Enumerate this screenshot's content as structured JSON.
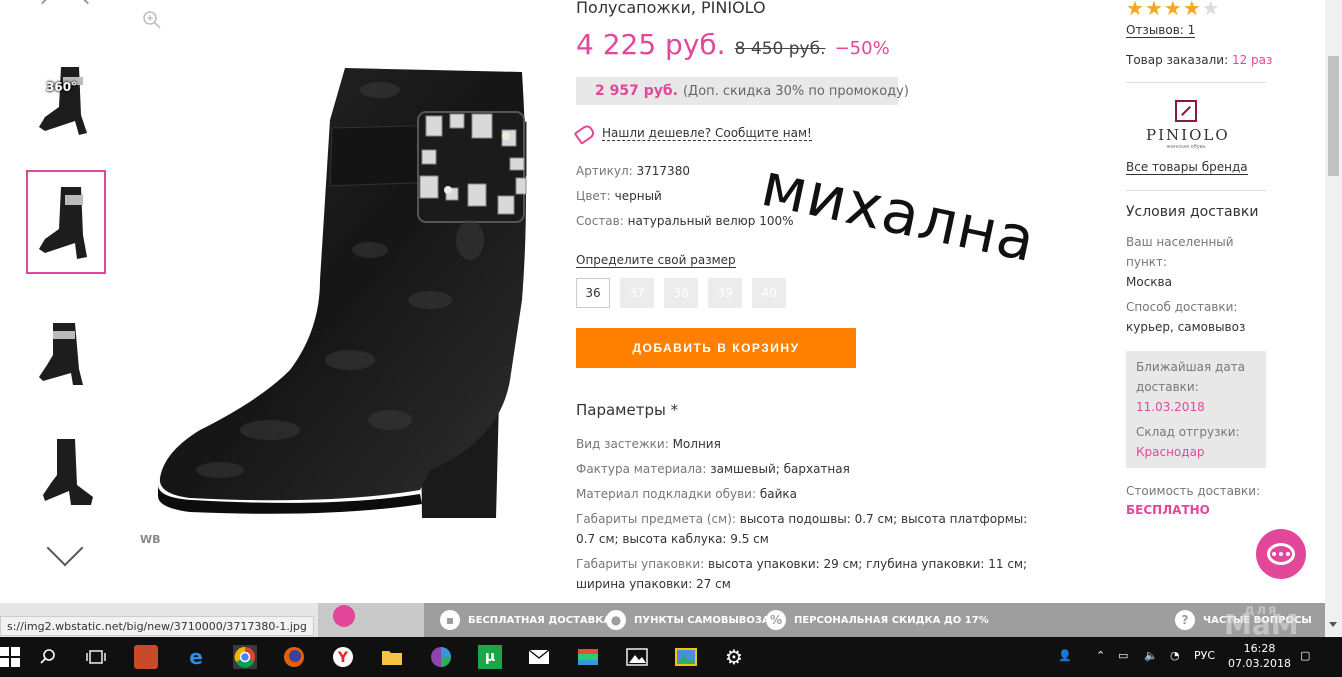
{
  "product": {
    "title": "Полусапожки, PINIOLO",
    "price": "4 225 руб.",
    "old_price": "8 450 руб.",
    "discount": "−50%",
    "promo_price": "2 957 руб.",
    "promo_note": "(Доп. скидка 30% по промокоду)",
    "cheaper_link": "Нашли дешевле? Сообщите нам!",
    "attributes": [
      {
        "key": "Артикул:",
        "value": "3717380"
      },
      {
        "key": "Цвет:",
        "value": "черный"
      },
      {
        "key": "Состав:",
        "value": "натуральный велюр 100%"
      }
    ],
    "size_title": "Определите свой размер",
    "sizes": [
      "36",
      "37",
      "38",
      "39",
      "40"
    ],
    "cart_button": "ДОБАВИТЬ В КОРЗИНУ",
    "params_title": "Параметры *",
    "params": [
      {
        "key": "Вид застежки:",
        "value": "Молния"
      },
      {
        "key": "Фактура материала:",
        "value": "замшевый; бархатная"
      },
      {
        "key": "Материал подкладки обуви:",
        "value": "байка"
      },
      {
        "key": "Габариты предмета (см):",
        "value": "высота подошвы: 0.7 см; высота платформы: 0.7 см; высота каблука: 9.5 см"
      },
      {
        "key": "Габариты упаковки:",
        "value": "высота упаковки: 29 см; глубина упаковки: 11 см; ширина упаковки: 27 см"
      }
    ]
  },
  "handwriting": "михална",
  "gallery": {
    "badge_360": "360°",
    "wb_mark": "WB"
  },
  "sidebar": {
    "rating": 4,
    "reviews": "Отзывов: 1",
    "ordered_label": "Товар заказали:",
    "ordered_count": "12 раз",
    "brand_name": "PINIOLO",
    "brand_sub": "женская обувь",
    "brand_link": "Все товары бренда",
    "delivery_title": "Условия доставки",
    "locality_label": "Ваш населенный пункт:",
    "locality_value": "Москва",
    "method_label": "Способ доставки:",
    "method_value": "курьер, самовывоз",
    "nearest_label": "Ближайшая дата доставки:",
    "nearest_value": "11.03.2018",
    "warehouse_label": "Склад отгрузки:",
    "warehouse_value": "Краснодар",
    "cost_label": "Стоимость доставки:",
    "cost_value": "БЕСПЛАТНО"
  },
  "bottom_bar": {
    "items": [
      "БЕСПЛАТНАЯ ДОСТАВКА",
      "ПУНКТЫ САМОВЫВОЗА",
      "ПЕРСОНАЛЬНАЯ СКИДКА ДО 17%",
      "ЧАСТЫЕ ВОПРОСЫ"
    ],
    "status_url": "s://img2.wbstatic.net/big/new/3710000/3717380-1.jpg"
  },
  "watermark": {
    "top": "для",
    "bottom": "МаМ"
  },
  "taskbar": {
    "lang": "РУС",
    "time": "16:28",
    "date": "07.03.2018"
  },
  "colors": {
    "accent": "#e3479a",
    "button": "#ff7f00"
  }
}
